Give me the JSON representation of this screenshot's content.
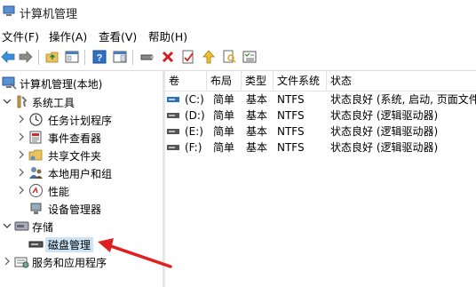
{
  "window": {
    "title": "计算机管理"
  },
  "menu": {
    "items": [
      "文件(F)",
      "操作(A)",
      "查看(V)",
      "帮助(H)"
    ]
  },
  "tree": {
    "root": "计算机管理(本地)",
    "system_tools": "系统工具",
    "task_scheduler": "任务计划程序",
    "event_viewer": "事件查看器",
    "shared_folders": "共享文件夹",
    "local_users": "本地用户和组",
    "performance": "性能",
    "device_manager": "设备管理器",
    "storage": "存储",
    "disk_management": "磁盘管理",
    "services_apps": "服务和应用程序"
  },
  "table": {
    "columns": [
      "卷",
      "布局",
      "类型",
      "文件系统",
      "状态"
    ],
    "rows": [
      {
        "volume": "(C:)",
        "layout": "简单",
        "type": "基本",
        "fs": "NTFS",
        "status": "状态良好 (系统, 启动, 页面文件"
      },
      {
        "volume": "(D:)",
        "layout": "简单",
        "type": "基本",
        "fs": "NTFS",
        "status": "状态良好 (逻辑驱动器)"
      },
      {
        "volume": "(E:)",
        "layout": "简单",
        "type": "基本",
        "fs": "NTFS",
        "status": "状态良好 (逻辑驱动器)"
      },
      {
        "volume": "(F:)",
        "layout": "简单",
        "type": "基本",
        "fs": "NTFS",
        "status": "状态良好 (逻辑驱动器)"
      }
    ]
  },
  "colors": {
    "selection": "#cce4f7",
    "arrow": "#e02020",
    "header_border": "#e3e3e3",
    "disk_blue": "#2d6fc4"
  }
}
